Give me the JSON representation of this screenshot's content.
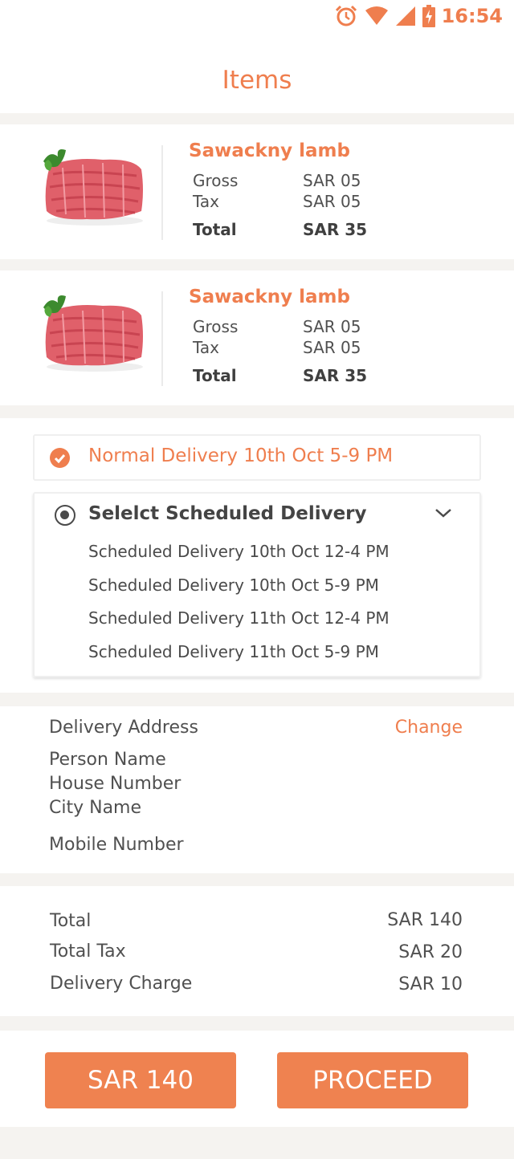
{
  "status_bar": {
    "time": "16:54",
    "icons": [
      "alarm-icon",
      "wifi-icon",
      "signal-icon",
      "battery-charging-icon"
    ],
    "accent_color": "#ef7e4e"
  },
  "header": {
    "title": "Items"
  },
  "items": [
    {
      "name": "Sawackny lamb",
      "image": "minced-meat-image",
      "gross_label": "Gross",
      "gross_value": "SAR 05",
      "tax_label": "Tax",
      "tax_value": "SAR 05",
      "total_label": "Total",
      "total_value": "SAR 35"
    },
    {
      "name": "Sawackny lamb",
      "image": "minced-meat-image",
      "gross_label": "Gross",
      "gross_value": "SAR 05",
      "tax_label": "Tax",
      "tax_value": "SAR 05",
      "total_label": "Total",
      "total_value": "SAR 35"
    }
  ],
  "delivery": {
    "normal_option": "Normal Delivery 10th Oct 5-9 PM",
    "normal_selected": true,
    "scheduled_label": "Selelct Scheduled Delivery",
    "scheduled_options": [
      "Scheduled Delivery 10th Oct 12-4 PM",
      "Scheduled Delivery 10th Oct 5-9 PM",
      "Scheduled Delivery 11th Oct 12-4 PM",
      "Scheduled Delivery 11th Oct 5-9 PM"
    ]
  },
  "address": {
    "heading": "Delivery Address",
    "change_label": "Change",
    "person_name": "Person Name",
    "house_number": "House Number",
    "city_name": "City Name",
    "mobile_number": "Mobile Number"
  },
  "totals": {
    "total_label": "Total",
    "total_value": "SAR 140",
    "tax_label": "Total Tax",
    "tax_value": "SAR 20",
    "delivery_label": "Delivery Charge",
    "delivery_value": "SAR 10"
  },
  "footer": {
    "amount_button": "SAR 140",
    "proceed_button": "PROCEED"
  }
}
